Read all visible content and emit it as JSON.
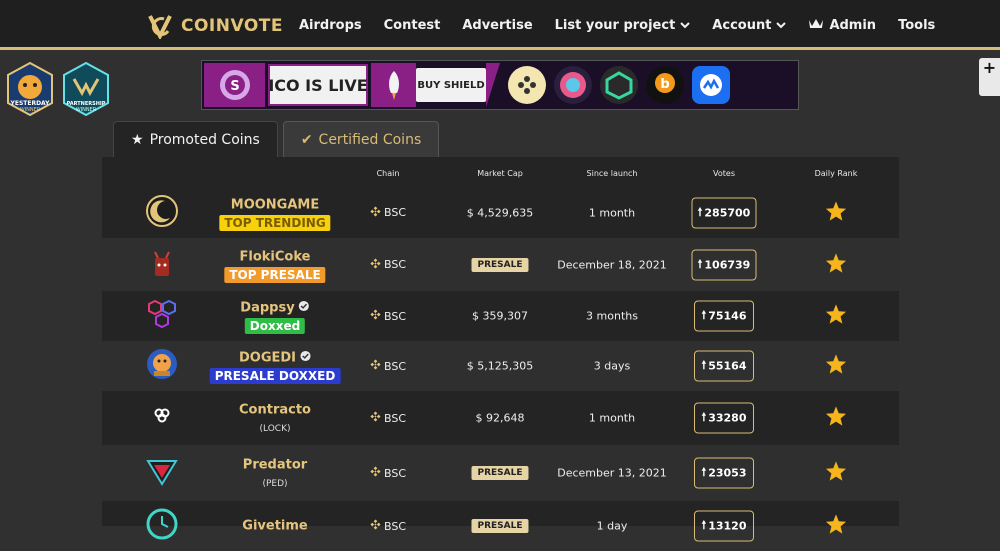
{
  "brand": {
    "name": "COINVOTE",
    "accent": "#d9bc74"
  },
  "nav": {
    "items": [
      {
        "label": "Airdrops",
        "dropdown": false
      },
      {
        "label": "Contest",
        "dropdown": false
      },
      {
        "label": "Advertise",
        "dropdown": false
      },
      {
        "label": "List your project",
        "dropdown": true
      },
      {
        "label": "Account",
        "dropdown": true
      },
      {
        "label": "Admin",
        "icon": "crown-icon"
      },
      {
        "label": "Tools",
        "dropdown": false
      }
    ]
  },
  "badges": [
    {
      "label": "YESTERDAY WINNER",
      "icon": "dog-badge-icon"
    },
    {
      "label": "PARTNERSHIP WINNER",
      "icon": "partnership-badge-icon"
    }
  ],
  "banner": {
    "ico_text": "ICO IS LIVE",
    "buy_text": "BUY SHIELD"
  },
  "tabs": [
    {
      "label": "Promoted Coins",
      "icon": "star-icon",
      "active": true
    },
    {
      "label": "Certified Coins",
      "icon": "check-icon",
      "active": false
    }
  ],
  "table": {
    "columns": [
      "Chain",
      "Market Cap",
      "Since launch",
      "Votes",
      "Daily Rank"
    ],
    "rows": [
      {
        "name": "MOONGAME",
        "verified": false,
        "tag": "TOP TRENDING",
        "tag_bg": "#f6d10c",
        "tag_color": "#7a5c00",
        "sub": "",
        "chain": "BSC",
        "market_cap": "$ 4,529,635",
        "presale": false,
        "since_launch": "1 month",
        "votes": "285700",
        "logo": "moon-logo-icon"
      },
      {
        "name": "FlokiCoke",
        "verified": false,
        "tag": "TOP PRESALE",
        "tag_bg": "#f29b2c",
        "tag_color": "#ffffff",
        "sub": "",
        "chain": "BSC",
        "market_cap": "PRESALE",
        "presale": true,
        "since_launch": "December 18, 2021",
        "votes": "106739",
        "logo": "coke-cup-logo-icon"
      },
      {
        "name": "Dappsy",
        "verified": true,
        "tag": "Doxxed",
        "tag_bg": "#2ebd45",
        "tag_color": "#ffffff",
        "sub": "",
        "chain": "BSC",
        "market_cap": "$ 359,307",
        "presale": false,
        "since_launch": "3 months",
        "votes": "75146",
        "logo": "hexagon-logo-icon"
      },
      {
        "name": "DOGEDI",
        "verified": true,
        "tag": "PRESALE DOXXED",
        "tag_bg": "#2b3ccf",
        "tag_color": "#ffffff",
        "sub": "",
        "chain": "BSC",
        "market_cap": "$ 5,125,305",
        "presale": false,
        "since_launch": "3 days",
        "votes": "55164",
        "logo": "doge-logo-icon"
      },
      {
        "name": "Contracto",
        "verified": false,
        "tag": "",
        "sub": "(LOCK)",
        "chain": "BSC",
        "market_cap": "$ 92,648",
        "presale": false,
        "since_launch": "1 month",
        "votes": "33280",
        "logo": "rings-logo-icon"
      },
      {
        "name": "Predator",
        "verified": false,
        "tag": "",
        "sub": "(PED)",
        "chain": "BSC",
        "market_cap": "PRESALE",
        "presale": true,
        "since_launch": "December 13, 2021",
        "votes": "23053",
        "logo": "predator-logo-icon"
      },
      {
        "name": "Givetime",
        "verified": false,
        "tag": "",
        "sub": "",
        "chain": "BSC",
        "market_cap": "PRESALE",
        "presale": true,
        "since_launch": "1 day",
        "votes": "13120",
        "logo": "givetime-logo-icon"
      }
    ]
  }
}
